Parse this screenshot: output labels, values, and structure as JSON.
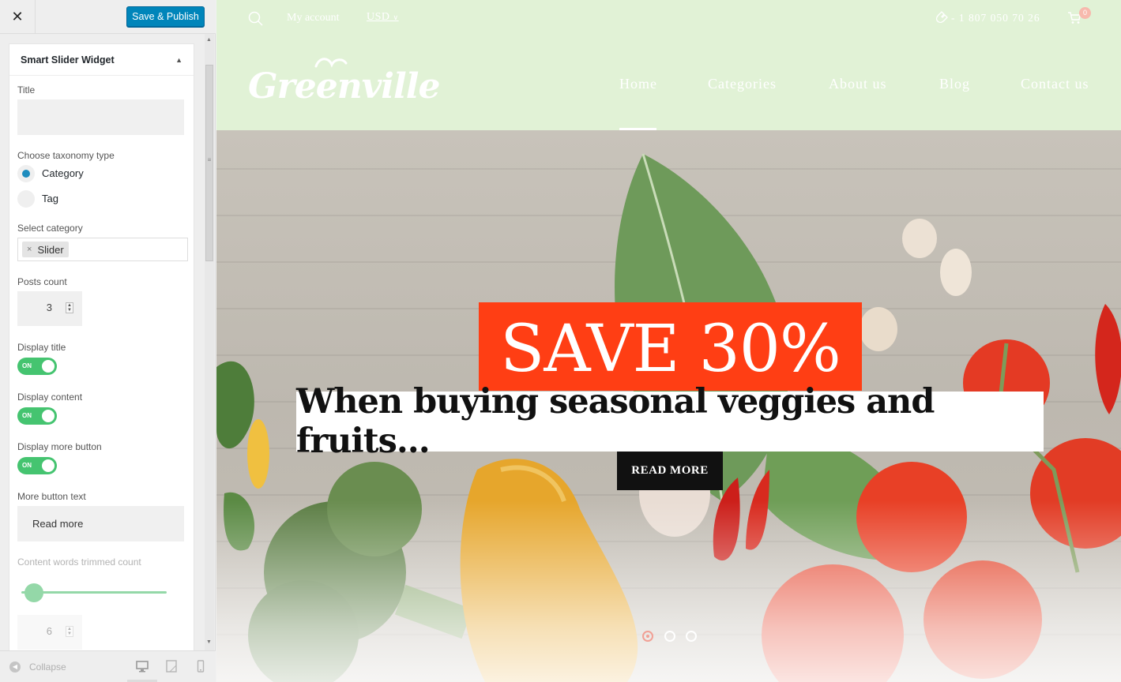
{
  "customizer": {
    "close_glyph": "✕",
    "save_publish_label": "Save & Publish",
    "widget": {
      "title": "Smart Slider Widget",
      "toggle_glyph": "▲",
      "fields": {
        "title_label": "Title",
        "title_value": "",
        "taxonomy_label": "Choose taxonomy type",
        "taxonomy_options": [
          "Category",
          "Tag"
        ],
        "taxonomy_selected": "Category",
        "select_category_label": "Select category",
        "selected_category": "Slider",
        "token_remove_glyph": "×",
        "posts_count_label": "Posts count",
        "posts_count_value": "3",
        "display_title_label": "Display title",
        "display_content_label": "Display content",
        "display_more_button_label": "Display more button",
        "toggle_on_text": "ON",
        "more_button_text_label": "More button text",
        "more_button_text_value": "Read more",
        "content_words_label": "Content words trimmed count",
        "content_words_value": "6"
      }
    },
    "footer": {
      "collapse_label": "Collapse",
      "devices": [
        "desktop-icon",
        "tablet-icon",
        "mobile-icon"
      ],
      "active_device": "desktop"
    }
  },
  "site": {
    "topbar": {
      "account_label": "My account",
      "currency_label": "USD",
      "phone": "1 807 050 70 26",
      "cart_count": "0"
    },
    "logo_text": "Greenville",
    "nav": [
      "Home",
      "Categories",
      "About us",
      "Blog",
      "Contact us"
    ],
    "nav_active": "Home",
    "hero": {
      "headline": "SAVE 30%",
      "subheadline": "When buying seasonal veggies and fruits...",
      "button_label": "READ MORE",
      "slide_count": 3,
      "active_slide": 1
    },
    "colors": {
      "header_bg": "#e1f2d6",
      "sale_red": "#ff3e14",
      "toggle_green": "#45c470",
      "publish_blue": "#0085ba"
    }
  }
}
